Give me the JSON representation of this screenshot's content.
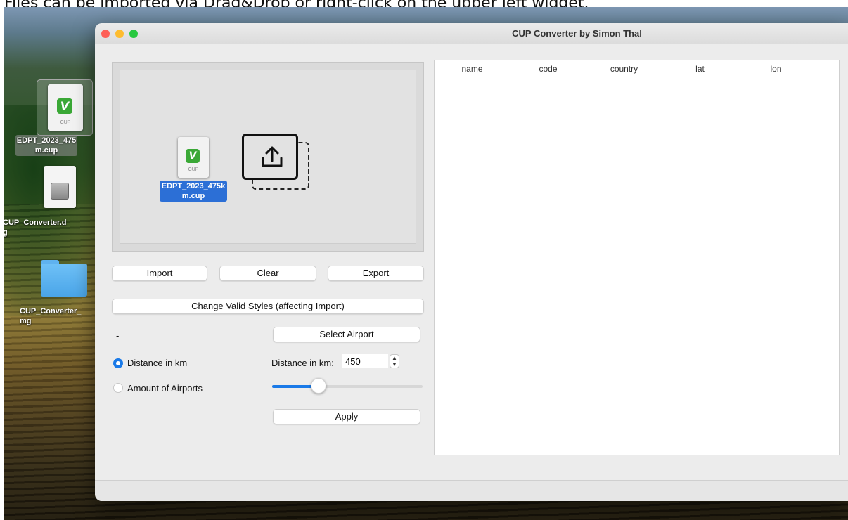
{
  "caption": "Files can be imported via Drag&Drop or right-click on the upper left widget.",
  "desktop": {
    "icons": [
      {
        "label": "EDPT_2023_475\nm.cup",
        "ext": "CUP"
      },
      {
        "label": "CUP_Converter.d\ng"
      },
      {
        "label": "CUP_Converter_\nmg"
      }
    ]
  },
  "window": {
    "title": "CUP Converter by Simon Thal",
    "traffic_colors": {
      "close": "#fe5f57",
      "minimize": "#febc2e",
      "maximize": "#28c840"
    }
  },
  "dropzone": {
    "file_ext": "CUP",
    "file_name_line1": "EDPT_2023_475k",
    "file_name_line2": "m.cup"
  },
  "buttons": {
    "import": "Import",
    "clear": "Clear",
    "export": "Export",
    "change_styles": "Change Valid Styles (affecting Import)",
    "select_airport": "Select Airport",
    "apply": "Apply"
  },
  "airport_label": "-",
  "options": {
    "distance_radio": "Distance in km",
    "amount_radio": "Amount of Airports",
    "selected": "distance"
  },
  "distance": {
    "label": "Distance in km:",
    "value": "450",
    "slider_fraction": 0.31
  },
  "table": {
    "columns": [
      "name",
      "code",
      "country",
      "lat",
      "lon"
    ],
    "rows": []
  },
  "colors": {
    "accent": "#1a7ae8",
    "file_selection": "#2c6fd6",
    "cup_logo": "#3aa836",
    "folder": "#5fb2ef"
  }
}
